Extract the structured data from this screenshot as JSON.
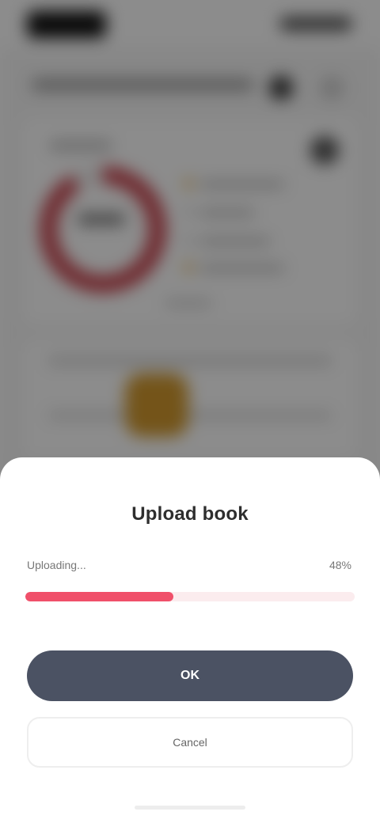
{
  "sheet": {
    "title": "Upload book",
    "progress_label": "Uploading...",
    "progress_value_text": "48%",
    "progress_fraction": 0.45,
    "primary_button_label": "OK",
    "secondary_button_label": "Cancel"
  },
  "colors": {
    "progress_fill": "#f0506a",
    "progress_track": "#fbecee",
    "primary_button": "#4b5263",
    "background_donut": "#c9454f",
    "background_badge": "#d39a2f"
  }
}
